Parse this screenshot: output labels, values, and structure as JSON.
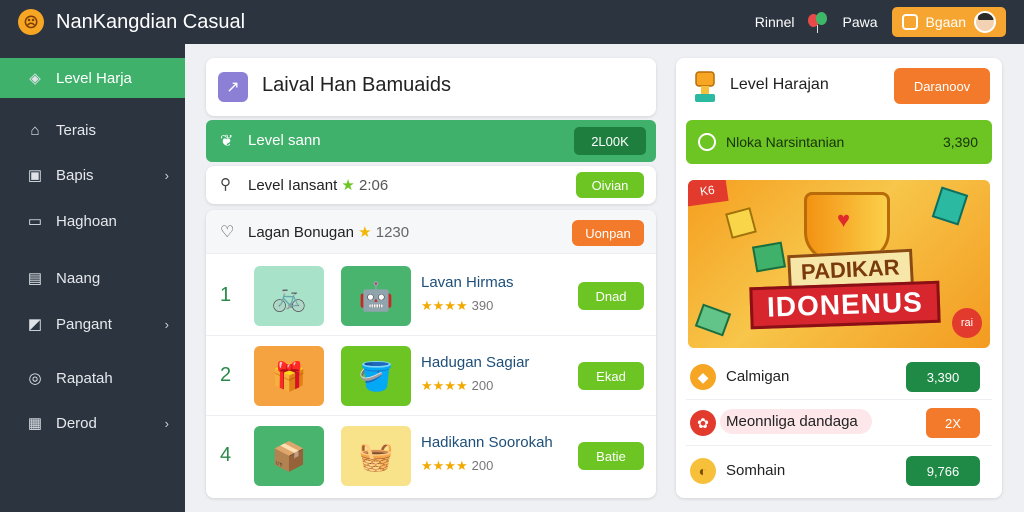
{
  "app": {
    "title": "NanKangdian Casual"
  },
  "topbar": {
    "link1": "Rinnel",
    "link2": "Pawa",
    "button_label": "Bgaan"
  },
  "sidebar": {
    "items": [
      {
        "label": "Level Harja",
        "icon": "diamond-icon",
        "active": true
      },
      {
        "label": "Terais",
        "icon": "home-icon"
      },
      {
        "label": "Bapis",
        "icon": "box-icon",
        "chevron": true
      },
      {
        "label": "Haghoan",
        "icon": "calendar-icon"
      },
      {
        "label": "Naang",
        "icon": "document-icon"
      },
      {
        "label": "Pangant",
        "icon": "chart-icon",
        "chevron": true
      },
      {
        "label": "Rapatah",
        "icon": "compass-icon"
      },
      {
        "label": "Derod",
        "icon": "briefcase-icon",
        "chevron": true
      }
    ]
  },
  "main": {
    "header_title": "Laival Han Bamuaids",
    "green_bar": {
      "label": "Level sann",
      "button": "2L00K"
    },
    "search_row": {
      "label": "Level Iansant",
      "value": "2:06",
      "button": "Oivian"
    },
    "list_head": {
      "label": "Lagan Bonugan",
      "value": "1230",
      "button": "Uonpan"
    },
    "rows": [
      {
        "rank": "1",
        "title": "Lavan Hirmas",
        "stars": "★★★★",
        "value": "390",
        "button": "Dnad"
      },
      {
        "rank": "2",
        "title": "Hadugan Sagiar",
        "stars": "★★★★",
        "value": "200",
        "button": "Ekad"
      },
      {
        "rank": "4",
        "title": "Hadikann Soorokah",
        "stars": "★★★★",
        "value": "200",
        "button": "Batie"
      }
    ]
  },
  "right": {
    "header_title": "Level Harajan",
    "header_button": "Daranoov",
    "green_bar": {
      "label": "Nloka Narsintanian",
      "value": "3,390"
    },
    "banner": {
      "ribbon": "K6",
      "line1": "PADIKAR",
      "line2": "IDONENUS",
      "corner": "rai"
    },
    "rows": [
      {
        "label": "Calmigan",
        "button": "3,390",
        "color": "#1f8a45"
      },
      {
        "label": "Meonnliga dandaga",
        "button": "2X",
        "color": "#f27a2a"
      },
      {
        "label": "Somhain",
        "button": "9,766",
        "color": "#1f8a45"
      }
    ]
  },
  "colors": {
    "accent_green": "#3fb16b",
    "lime": "#6cc522",
    "orange": "#f27a2a",
    "sidebar_bg": "#2c3440"
  }
}
